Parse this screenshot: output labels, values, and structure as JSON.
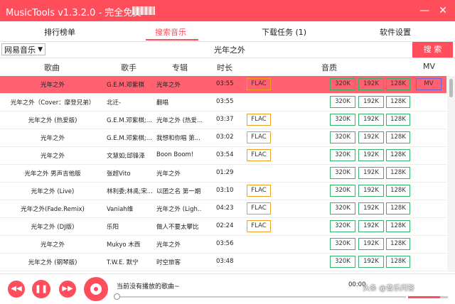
{
  "window": {
    "title": "MusicTools  v1.3.2.0  - 完全免费",
    "min_icon": "minimize-icon",
    "close_icon": "close-icon"
  },
  "tabs": [
    {
      "label": "排行榜单",
      "active": false
    },
    {
      "label": "搜索音乐",
      "active": true
    },
    {
      "label": "下载任务 (1)",
      "active": false
    },
    {
      "label": "软件设置",
      "active": false
    }
  ],
  "search": {
    "source": "网易音乐",
    "query": "光年之外",
    "button": "搜 索"
  },
  "table": {
    "headers": {
      "song": "歌曲",
      "artist": "歌手",
      "album": "专辑",
      "duration": "时长",
      "quality": "音质",
      "mv": "MV"
    },
    "rows": [
      {
        "song": "光年之外",
        "artist": "G.E.M.邓紫棋",
        "album": "光年之外",
        "duration": "03:55",
        "flac": "FLAC",
        "q320": "320K",
        "q192": "192K",
        "q128": "128K",
        "mv": "MV"
      },
      {
        "song": "光年之外（Cover：摩登兄弟）",
        "artist": "北迁-",
        "album": "翻唱",
        "duration": "03:55",
        "flac": "",
        "q320": "320K",
        "q192": "192K",
        "q128": "128K",
        "mv": ""
      },
      {
        "song": "光年之外 (热爱版)",
        "artist": "G.E.M.邓紫棋;...",
        "album": "光年之外 (热爱...",
        "duration": "03:37",
        "flac": "FLAC",
        "q320": "320K",
        "q192": "192K",
        "q128": "128K",
        "mv": ""
      },
      {
        "song": "光年之外",
        "artist": "G.E.M.邓紫棋;...",
        "album": "我想和你唱 第...",
        "duration": "03:02",
        "flac": "FLAC",
        "q320": "320K",
        "q192": "192K",
        "q128": "128K",
        "mv": ""
      },
      {
        "song": "光年之外",
        "artist": "文慧如;邱锋泽",
        "album": "Boon Boom!",
        "duration": "03:54",
        "flac": "FLAC",
        "q320": "320K",
        "q192": "192K",
        "q128": "128K",
        "mv": ""
      },
      {
        "song": "光年之外 男声吉他版",
        "artist": "张超Vito",
        "album": "光年之外",
        "duration": "01:29",
        "flac": "",
        "q320": "320K",
        "q192": "192K",
        "q128": "128K",
        "mv": ""
      },
      {
        "song": "光年之外 (Live)",
        "artist": "林利委;林禹;宋...",
        "album": "以团之名 第一期",
        "duration": "03:10",
        "flac": "FLAC",
        "q320": "320K",
        "q192": "192K",
        "q128": "128K",
        "mv": ""
      },
      {
        "song": "光年之外(Fade.Remix)",
        "artist": "Vaniah维",
        "album": "光年之外 (Ligh...",
        "duration": "04:23",
        "flac": "FLAC",
        "q320": "320K",
        "q192": "192K",
        "q128": "128K",
        "mv": ""
      },
      {
        "song": "光年之外 (DJ版)",
        "artist": "乐阳",
        "album": "做人不要太攀比",
        "duration": "02:24",
        "flac": "FLAC",
        "q320": "320K",
        "q192": "192K",
        "q128": "128K",
        "mv": ""
      },
      {
        "song": "光年之外",
        "artist": "Mukyo 木西",
        "album": "光年之外",
        "duration": "03:56",
        "flac": "",
        "q320": "320K",
        "q192": "192K",
        "q128": "128K",
        "mv": ""
      },
      {
        "song": "光年之外 (钢琴版)",
        "artist": "T.W.E. 默宁",
        "album": "时空旅客",
        "duration": "03:48",
        "flac": "",
        "q320": "320K",
        "q192": "192K",
        "q128": "128K",
        "mv": ""
      }
    ]
  },
  "player": {
    "now_playing": "当前没有播放的歌曲~",
    "time": "00:00",
    "volume_fraction": 0.8,
    "watermark": "头条 @音乐问答"
  },
  "colors": {
    "accent": "#ff4d5b",
    "quality_green": "#37b36a",
    "flac_orange": "#f0a020",
    "mv_blue": "#6a6ad8"
  }
}
